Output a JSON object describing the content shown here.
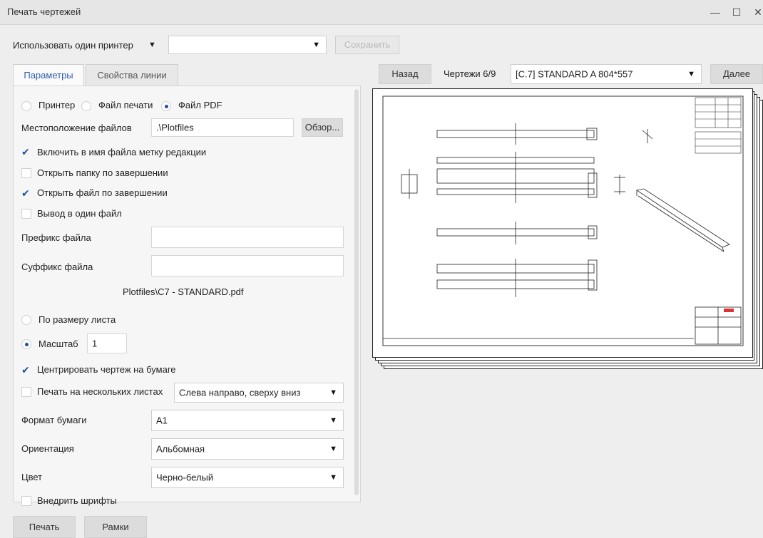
{
  "window": {
    "title": "Печать чертежей",
    "minimize": "—",
    "maximize": "☐",
    "close": "✕"
  },
  "top": {
    "printer_mode": "Использовать один принтер",
    "preset_value": "",
    "save_label": "Сохранить"
  },
  "tabs": [
    {
      "label": "Параметры",
      "active": true
    },
    {
      "label": "Свойства линии",
      "active": false
    }
  ],
  "output": {
    "options": [
      {
        "label": "Принтер",
        "selected": false
      },
      {
        "label": "Файл печати",
        "selected": false
      },
      {
        "label": "Файл PDF",
        "selected": true
      }
    ]
  },
  "location": {
    "label": "Местоположение файлов",
    "value": ".\\Plotfiles",
    "browse_label": "Обзор..."
  },
  "checks": {
    "revision": {
      "label": "Включить в имя файла метку редакции",
      "checked": true
    },
    "open_folder": {
      "label": "Открыть папку по завершении",
      "checked": false
    },
    "open_file": {
      "label": "Открыть файл по завершении",
      "checked": true
    },
    "single_file": {
      "label": "Вывод в один файл",
      "checked": false
    },
    "center": {
      "label": "Центрировать чертеж на бумаге",
      "checked": true
    },
    "multi_sheet": {
      "label": "Печать на нескольких листах",
      "checked": false
    },
    "embed_fonts": {
      "label": "Внедрить шрифты",
      "checked": false
    }
  },
  "prefix": {
    "label": "Префикс файла",
    "value": ""
  },
  "suffix": {
    "label": "Суффикс файла",
    "value": ""
  },
  "result_path": "Plotfiles\\C7 - STANDARD.pdf",
  "scale": {
    "fit_label": "По размеру листа",
    "fit_selected": false,
    "scale_label": "Масштаб",
    "scale_selected": true,
    "scale_value": "1"
  },
  "multi_sheet_order": "Слева направо, сверху вниз",
  "paper": {
    "label": "Формат бумаги",
    "value": "A1"
  },
  "orientation": {
    "label": "Ориентация",
    "value": "Альбомная"
  },
  "color": {
    "label": "Цвет",
    "value": "Черно-белый"
  },
  "bottom": {
    "print_label": "Печать",
    "frames_label": "Рамки"
  },
  "preview": {
    "back_label": "Назад",
    "counter": "Чертежи 6/9",
    "drawing": "[C.7] STANDARD A 804*557",
    "next_label": "Далее"
  },
  "icons": {
    "dropdown": "▼",
    "check": "✔"
  }
}
